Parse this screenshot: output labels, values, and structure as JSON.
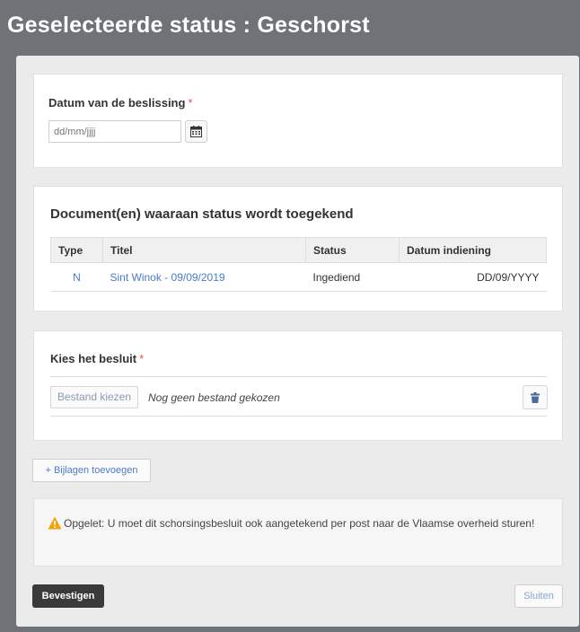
{
  "header": {
    "title": "Geselecteerde status : Geschorst"
  },
  "date_section": {
    "label": "Datum van de beslissing",
    "required_mark": "*",
    "placeholder": "dd/mm/jjjj",
    "calendar_icon": "calendar-icon"
  },
  "documents_section": {
    "title": "Document(en) waaraan status wordt toegekend",
    "columns": [
      "Type",
      "Titel",
      "Status",
      "Datum indiening"
    ],
    "rows": [
      {
        "type": "N",
        "title": "Sint Winok - 09/09/2019",
        "status": "Ingediend",
        "date": "DD/09/YYYY"
      }
    ]
  },
  "decision_section": {
    "label": "Kies het besluit",
    "required_mark": "*",
    "file_button": "Bestand kiezen",
    "file_status": "Nog geen bestand gekozen",
    "delete_icon": "trash-icon"
  },
  "attachments": {
    "add_label": "+ Bijlagen toevoegen"
  },
  "warning": {
    "icon": "warning-icon",
    "text": "Opgelet: U moet dit schorsingsbesluit ook aangetekend per post naar de Vlaamse overheid sturen!"
  },
  "footer": {
    "confirm_label": "Bevestigen",
    "close_label": "Sluiten"
  },
  "colors": {
    "header_bg": "#6f7277",
    "link": "#4a7cc8",
    "required": "#d9534f",
    "warning_icon": "#f0a30a",
    "primary_btn": "#3a3a3a"
  }
}
